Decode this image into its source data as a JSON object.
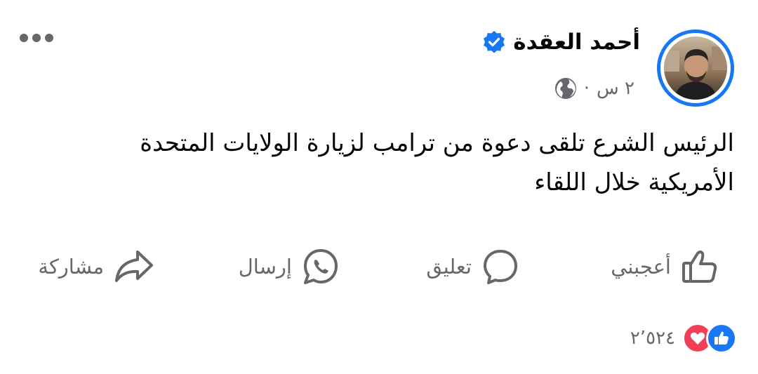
{
  "author": {
    "name": "أحمد العقدة",
    "verified": true
  },
  "meta": {
    "time": "٢ س",
    "separator": "·",
    "audience_icon": "globe-icon"
  },
  "post": {
    "line1": "الرئيس الشرع تلقى دعوة من ترامب لزيارة الولايات المتحدة",
    "line2": "الأمريكية خلال اللقاء"
  },
  "actions": {
    "like": "أعجبني",
    "comment": "تعليق",
    "send": "إرسال",
    "share": "مشاركة"
  },
  "reactions": {
    "types": [
      "like",
      "love"
    ],
    "count": "٢٬٥٢٤"
  },
  "colors": {
    "accent": "#1877f2",
    "secondary_text": "#65676b",
    "love": "#f33e58"
  }
}
